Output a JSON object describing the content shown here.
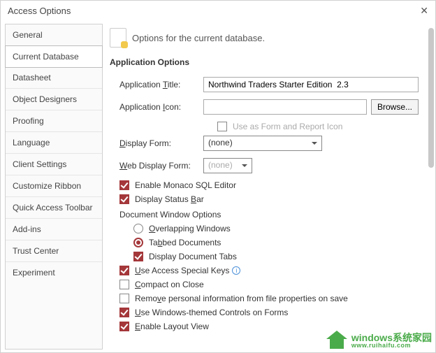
{
  "title": "Access Options",
  "sidebar": {
    "items": [
      {
        "label": "General"
      },
      {
        "label": "Current Database"
      },
      {
        "label": "Datasheet"
      },
      {
        "label": "Object Designers"
      },
      {
        "label": "Proofing"
      },
      {
        "label": "Language"
      },
      {
        "label": "Client Settings"
      },
      {
        "label": "Customize Ribbon"
      },
      {
        "label": "Quick Access Toolbar"
      },
      {
        "label": "Add-ins"
      },
      {
        "label": "Trust Center"
      },
      {
        "label": "Experiment"
      }
    ],
    "active_index": 1
  },
  "header": {
    "description": "Options for the current database."
  },
  "section_title": "Application Options",
  "app_title": {
    "label": "Application Title:",
    "value": "Northwind Traders Starter Edition  2.3"
  },
  "app_icon": {
    "label": "Application Icon:",
    "value": "",
    "browse": "Browse...",
    "use_as_form_report": "Use as Form and Report Icon"
  },
  "display_form": {
    "label": "Display Form:",
    "value": "(none)"
  },
  "web_display_form": {
    "label": "Web Display Form:",
    "value": "(none)"
  },
  "checks": {
    "monaco": "Enable Monaco SQL Editor",
    "statusbar": "Display Status Bar",
    "doc_window_header": "Document Window Options",
    "overlapping": "Overlapping Windows",
    "tabbed": "Tabbed Documents",
    "display_tabs": "Display Document Tabs",
    "special_keys": "Use Access Special Keys",
    "compact": "Compact on Close",
    "remove_personal": "Remove personal information from file properties on save",
    "themed_controls": "Use Windows-themed Controls on Forms",
    "layout_view": "Enable Layout View"
  },
  "watermark": {
    "line1": "windows系统家园",
    "line2": "www.ruihaifu.com"
  }
}
